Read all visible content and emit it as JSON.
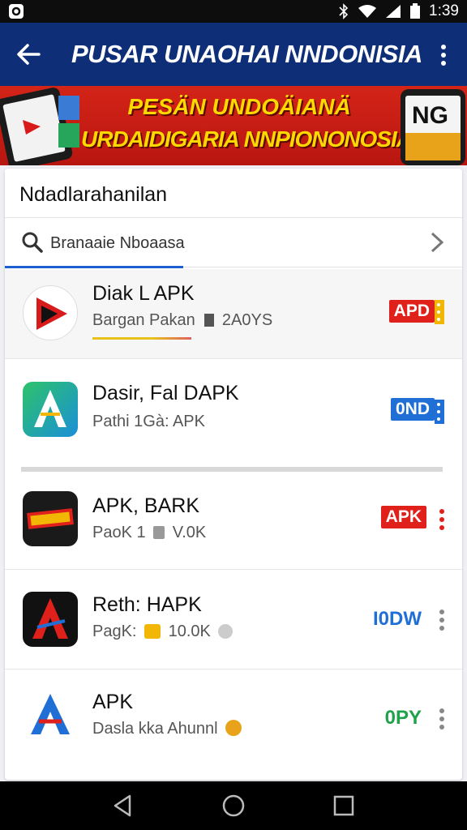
{
  "status": {
    "time": "1:39"
  },
  "appbar": {
    "title": "PUSAR UNAOHAI NNDONISIA"
  },
  "banner": {
    "line1": "PESÄN UNDOÄIANÄ",
    "line2": "URDAIDIGARIA NNPIONONOSIA",
    "badge_text": "NG"
  },
  "section": {
    "title": "Ndadlarahanilan"
  },
  "search": {
    "text": "Branaaie Nboaasa"
  },
  "apps": [
    {
      "name": "Diak L APK",
      "sub": "Bargan Pakan",
      "sub2": "2A0YS",
      "badge": "APD",
      "badge_color": "#e0201b",
      "badge_text_color": "#ffffff",
      "more_color": "#f2b705"
    },
    {
      "name": "Dasir, Fal DAPK",
      "sub": "Pathi 1Gà: APK",
      "badge": "0ND",
      "badge_color": "#1f6fd6",
      "badge_text_color": "#ffffff",
      "more_color": "#ffffff"
    },
    {
      "name": "APK, BARK",
      "sub": "PaoK 1",
      "sub2": "V.0K",
      "badge": "APK",
      "badge_color": "#e0201b",
      "badge_text_color": "#ffffff",
      "more_color": "#e0201b"
    },
    {
      "name": "Reth: HAPK",
      "sub": "PagK:",
      "sub2": "10.0K",
      "badge": "I0DW",
      "badge_color": "transparent",
      "badge_text_color": "#1f6fd6",
      "more_color": "#888888"
    },
    {
      "name": "APK",
      "sub": "Dasla kka Ahunnl",
      "badge": "0PY",
      "badge_color": "transparent",
      "badge_text_color": "#1fa24a",
      "more_color": "#888888"
    }
  ],
  "icons": {
    "back": "arrow-left-icon",
    "menu": "overflow-menu-icon",
    "search": "search-icon",
    "chevron": "chevron-right-icon",
    "nav_back": "nav-back-icon",
    "nav_home": "nav-home-icon",
    "nav_recent": "nav-recents-icon"
  }
}
